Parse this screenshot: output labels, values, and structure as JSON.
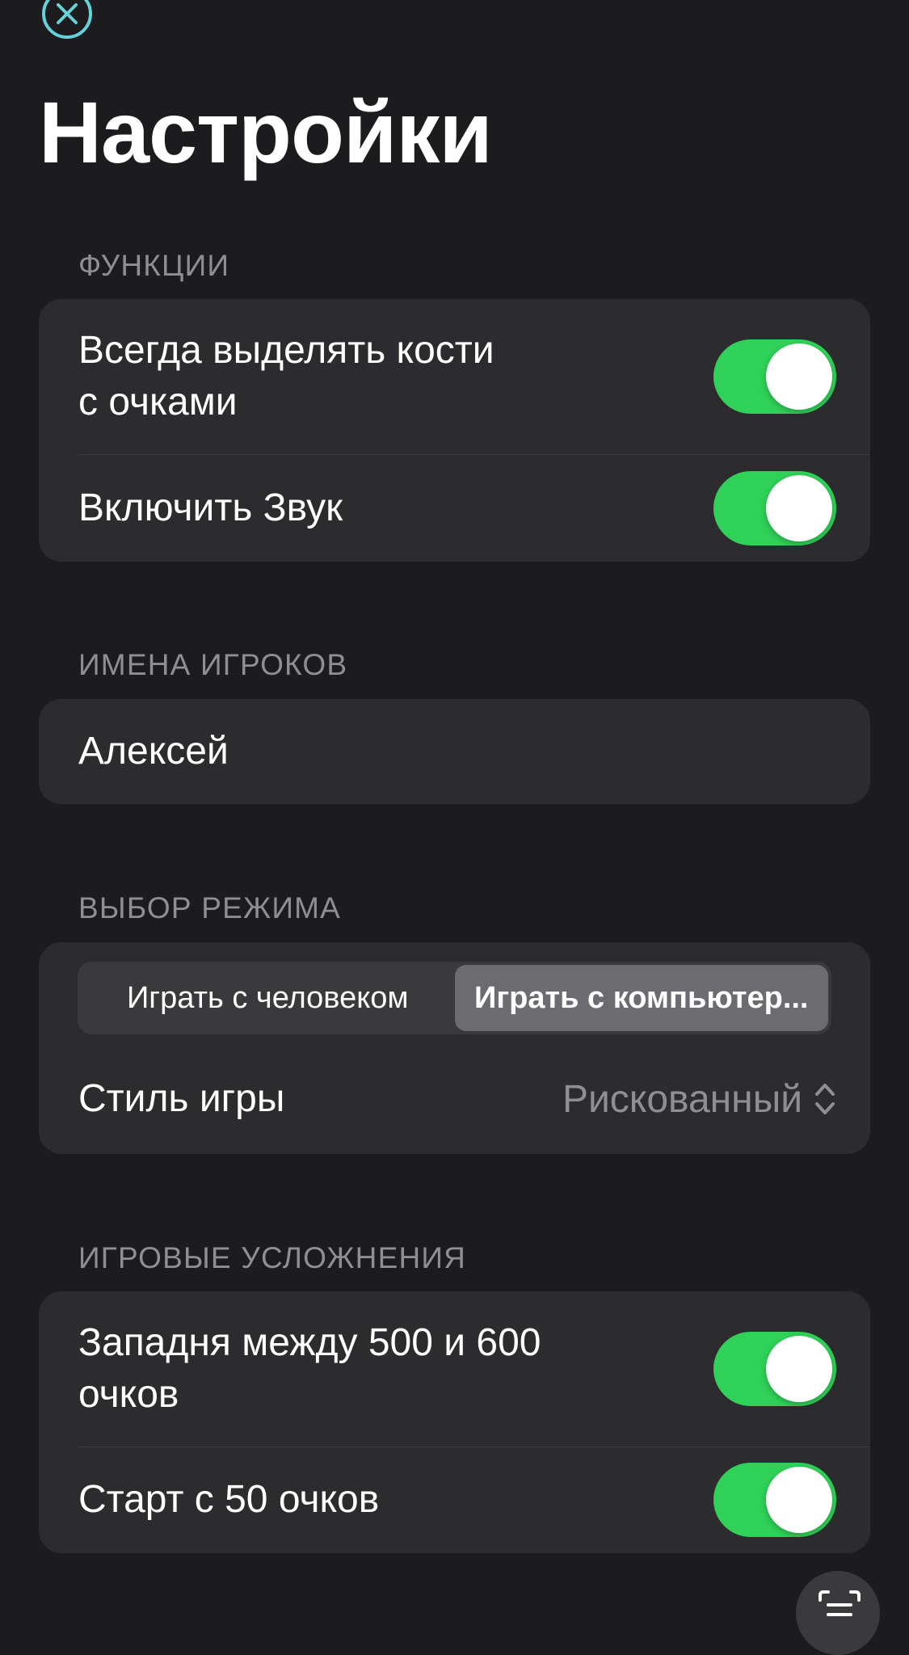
{
  "title": "Настройки",
  "sections": {
    "features": {
      "header": "ФУНКЦИИ",
      "rows": [
        {
          "line1": "Всегда выделять кости",
          "line2": "с очками",
          "on": true
        },
        {
          "label": "Включить Звук",
          "on": true
        }
      ]
    },
    "players": {
      "header": "ИМЕНА ИГРОКОВ",
      "name_value": "Алексей"
    },
    "mode": {
      "header": "ВЫБОР РЕЖИМА",
      "segments": [
        "Играть с человеком",
        "Играть с компьютер..."
      ],
      "selected_segment": 1,
      "style_label": "Стиль игры",
      "style_value": "Рискованный"
    },
    "complications": {
      "header": "ИГРОВЫЕ УСЛОЖНЕНИЯ",
      "rows": [
        {
          "line1": "Западня между 500 и 600",
          "line2": "очков",
          "on": true
        },
        {
          "label": "Старт с 50 очков",
          "on": true
        }
      ]
    }
  },
  "icons": {
    "close": "close-icon",
    "toggle_selector": "chevron-up-down-icon",
    "fab": "list-icon"
  },
  "colors": {
    "background": "#1c1c1e",
    "card": "#2c2c2e",
    "toggle_on": "#30d158",
    "accent_close": "#64d2d8",
    "secondary_text": "#8e8e93"
  }
}
